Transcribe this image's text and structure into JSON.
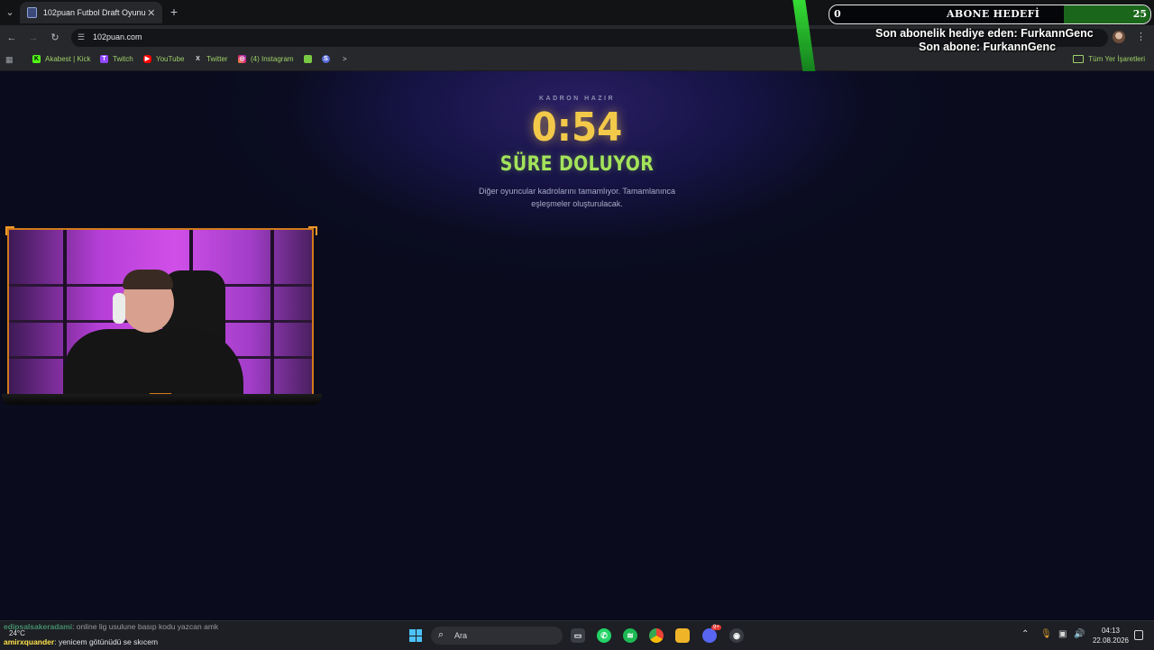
{
  "browser": {
    "tab_title": "102puan Futbol Draft Oyunu",
    "url": "102puan.com",
    "bookmarks": [
      "Akabest | Kick",
      "Twitch",
      "YouTube",
      "Twitter",
      "(4) Instagram"
    ],
    "bookmarks_overflow": ">",
    "all_bookmarks": "Tüm Yer İşaretleri"
  },
  "overlay": {
    "goal_current": "0",
    "goal_title": "ABONE HEDEFİ",
    "goal_target": "25",
    "gift_line": "Son abonelik hediye eden: FurkannGenc",
    "sub_line": "Son abone: FurkannGenc"
  },
  "draft": {
    "ready_label": "KADRON HAZIR",
    "timer": "0:54",
    "status": "SÜRE DOLUYOR",
    "note_line1": "Diğer oyuncular kadrolarını tamamlıyor. Tamamlanınca",
    "note_line2": "eşleşmeler oluşturulacak."
  },
  "chat": [
    {
      "user": "edipsalsakeradami",
      "msg": ": online lig usulune basıp kodu yazcan amk"
    },
    {
      "user": "amirxquander",
      "msg": ": yenicem götünüdü se skıcem"
    }
  ],
  "taskbar": {
    "weather": "24°C",
    "search_placeholder": "Ara",
    "clock_time": "04:13",
    "clock_date": "22.08.2026",
    "discord_badge": "9+"
  },
  "colors": {
    "timer": "#f3c94a",
    "status": "#a3e35a",
    "bookmark_text": "#9fcf6a",
    "cam_frame": "#d17a1c"
  }
}
